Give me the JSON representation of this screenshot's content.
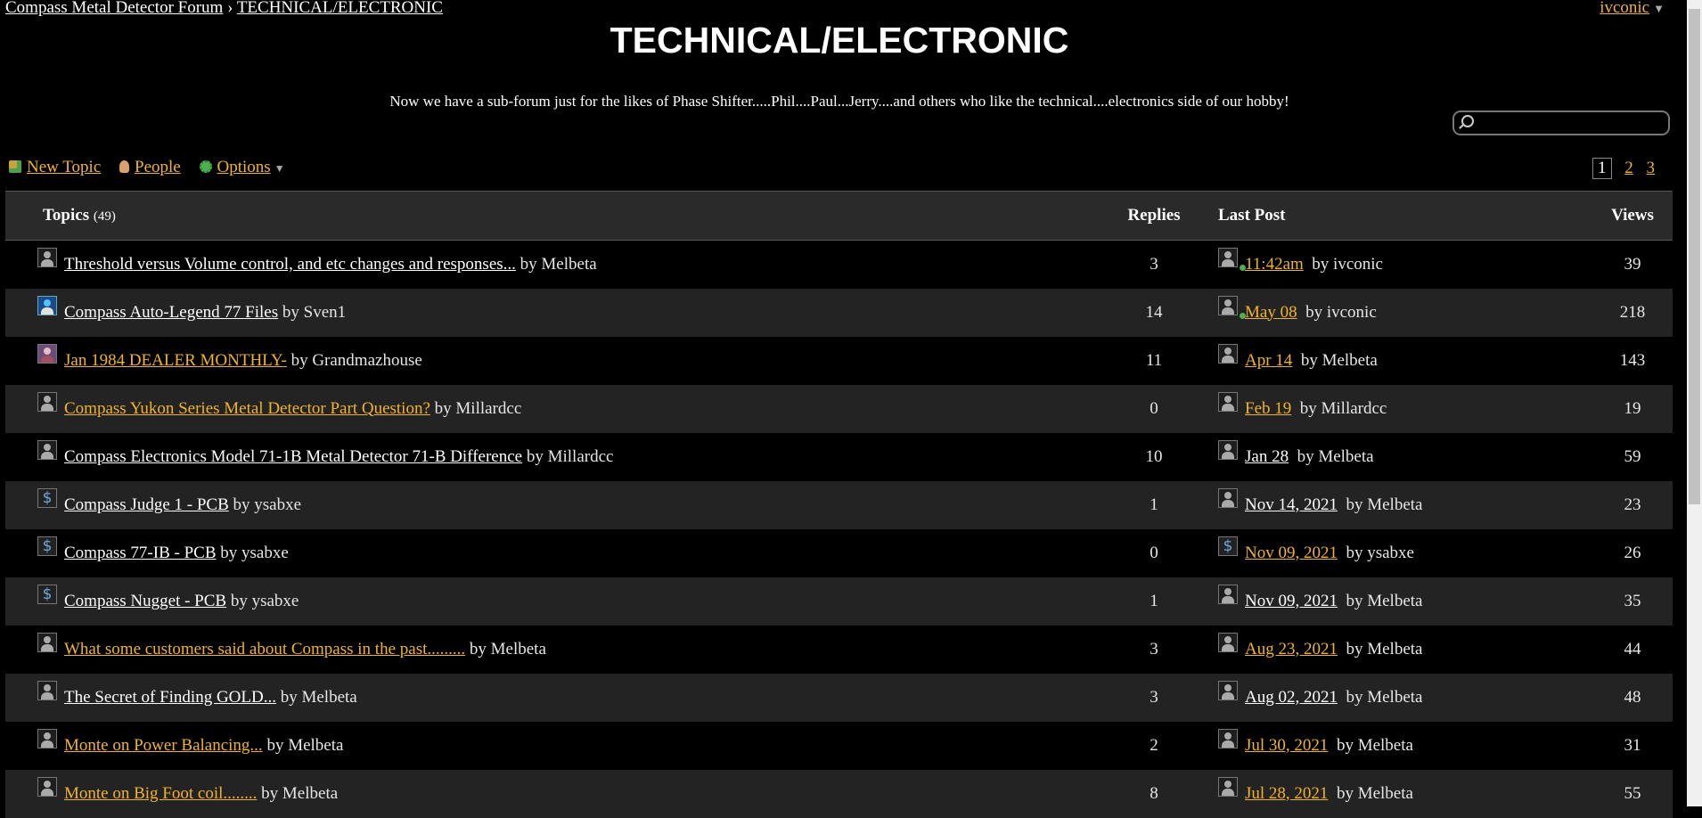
{
  "breadcrumb": {
    "forum": "Compass Metal Detector Forum",
    "sep": "›",
    "section": "TECHNICAL/ELECTRONIC"
  },
  "user": {
    "name": "ivconic"
  },
  "title": "TECHNICAL/ELECTRONIC",
  "description": "Now we have a sub-forum just for the likes of Phase Shifter.....Phil....Paul...Jerry....and others who like the technical....electronics side of our hobby!",
  "search": {
    "placeholder": ""
  },
  "toolbar": {
    "new_topic": "New Topic",
    "people": "People",
    "options": "Options"
  },
  "pages": [
    "1",
    "2",
    "3"
  ],
  "columns": {
    "topics": "Topics",
    "topics_count": "(49)",
    "replies": "Replies",
    "last_post": "Last Post",
    "views": "Views"
  },
  "topics": [
    {
      "title": "Threshold versus Volume control, and etc changes and responses...",
      "author": "by Melbeta",
      "replies": "3",
      "last_date": "11:42am",
      "last_author": "by ivconic",
      "views": "39"
    },
    {
      "title": "Compass Auto-Legend 77 Files",
      "author": "by Sven1",
      "replies": "14",
      "last_date": "May 08",
      "last_author": "by ivconic",
      "views": "218"
    },
    {
      "title": "Jan 1984 DEALER MONTHLY-",
      "author": "by Grandmazhouse",
      "replies": "11",
      "last_date": "Apr 14",
      "last_author": "by Melbeta",
      "views": "143"
    },
    {
      "title": "Compass Yukon Series Metal Detector Part Question?",
      "author": "by Millardcc",
      "replies": "0",
      "last_date": "Feb 19",
      "last_author": "by Millardcc",
      "views": "19"
    },
    {
      "title": "Compass Electronics Model 71-1B Metal Detector 71-B Difference",
      "author": "by Millardcc",
      "replies": "10",
      "last_date": "Jan 28",
      "last_author": "by Melbeta",
      "views": "59"
    },
    {
      "title": "Compass Judge 1 - PCB",
      "author": "by ysabxe",
      "replies": "1",
      "last_date": "Nov 14, 2021",
      "last_author": "by Melbeta",
      "views": "23"
    },
    {
      "title": "Compass 77-IB - PCB",
      "author": "by ysabxe",
      "replies": "0",
      "last_date": "Nov 09, 2021",
      "last_author": "by ysabxe",
      "views": "26"
    },
    {
      "title": "Compass Nugget - PCB",
      "author": "by ysabxe",
      "replies": "1",
      "last_date": "Nov 09, 2021",
      "last_author": "by Melbeta",
      "views": "35"
    },
    {
      "title": "What some customers said about Compass in the past.........",
      "author": "by Melbeta",
      "replies": "3",
      "last_date": "Aug 23, 2021",
      "last_author": "by Melbeta",
      "views": "44"
    },
    {
      "title": "The Secret of Finding GOLD...",
      "author": "by Melbeta",
      "replies": "3",
      "last_date": "Aug 02, 2021",
      "last_author": "by Melbeta",
      "views": "48"
    },
    {
      "title": "Monte on Power Balancing...",
      "author": "by Melbeta",
      "replies": "2",
      "last_date": "Jul 30, 2021",
      "last_author": "by Melbeta",
      "views": "31"
    },
    {
      "title": "Monte on Big Foot coil........",
      "author": "by Melbeta",
      "replies": "8",
      "last_date": "Jul 28, 2021",
      "last_author": "by Melbeta",
      "views": "55"
    }
  ],
  "colors": {
    "unread_link": "#f0b429",
    "read_link": "#ffffff",
    "row_alt": "#232323",
    "header_bg": "#2a2a2a"
  }
}
